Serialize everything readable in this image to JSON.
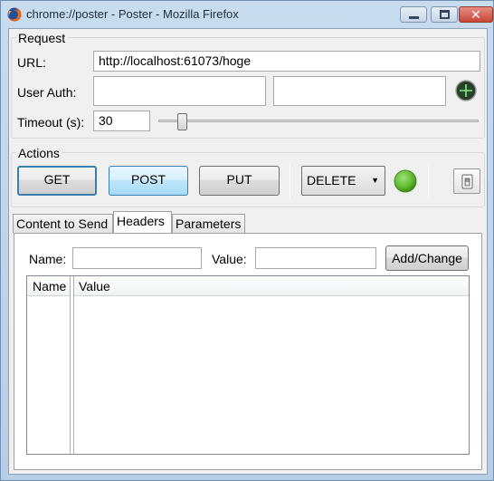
{
  "window": {
    "title": "chrome://poster - Poster - Mozilla Firefox",
    "app_icon": "firefox-icon",
    "controls": {
      "minimize": "minimize-icon",
      "maximize": "maximize-icon",
      "close": "close-icon"
    }
  },
  "request": {
    "legend": "Request",
    "url_label": "URL:",
    "url_value": "http://localhost:61073/hoge",
    "user_auth_label": "User Auth:",
    "user_value": "",
    "password_value": "",
    "auth_icon": "google-login-icon",
    "timeout_label": "Timeout (s):",
    "timeout_value": "30",
    "timeout_slider_level": 0.06
  },
  "actions": {
    "legend": "Actions",
    "get_label": "GET",
    "post_label": "POST",
    "put_label": "PUT",
    "method_selected": "DELETE",
    "go_icon": "green-circle-icon",
    "settings_icon": "switch-icon"
  },
  "tabs": [
    {
      "label": "Content to Send"
    },
    {
      "label": "Headers",
      "active": true
    },
    {
      "label": "Parameters"
    }
  ],
  "headers": {
    "name_label": "Name:",
    "name_value": "",
    "value_label": "Value:",
    "value_value": "",
    "add_button": "Add/Change",
    "columns": [
      "Name",
      "Value"
    ],
    "rows": []
  },
  "colors": {
    "accent": "#3c7fb1",
    "go_green": "#5cb82c",
    "title_bar": "#c9dcef"
  }
}
